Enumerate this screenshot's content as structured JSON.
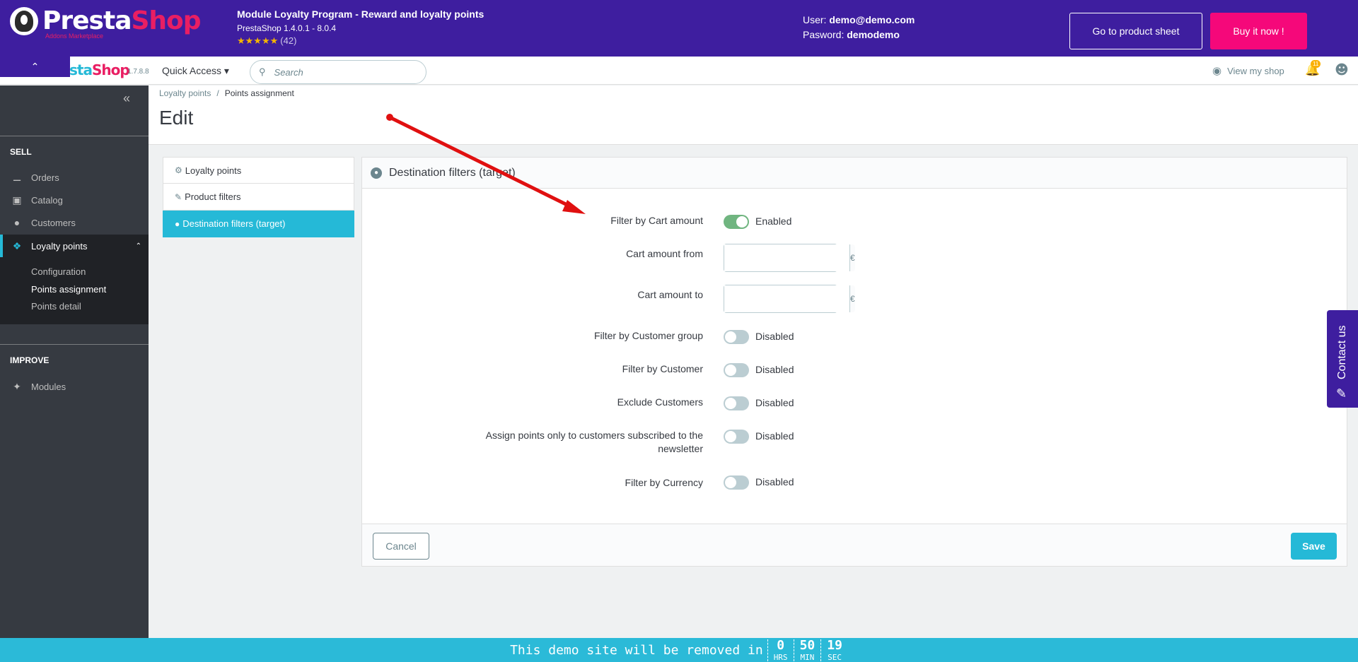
{
  "banner": {
    "logo_part1": "Presta",
    "logo_part2": "Shop",
    "logo_sub": "Addons Marketplace",
    "module_title": "Module Loyalty Program - Reward and loyalty points",
    "module_version": "PrestaShop 1.4.0.1 - 8.0.4",
    "rating_stars": "★★★★★",
    "rating_count": "(42)",
    "user_label": "User:",
    "user_value": "demo@demo.com",
    "password_label": "Pasword:",
    "password_value": "demodemo",
    "product_sheet_button": "Go to product sheet",
    "buy_button": "Buy it now !"
  },
  "header": {
    "collapse_icon": "chevron-up-icon",
    "logo_part1": "sta",
    "logo_part2": "Shop",
    "version": "1.7.8.8",
    "quick_access": "Quick Access ▾",
    "search_placeholder": "Search",
    "view_shop": "View my shop",
    "notification_count": "11"
  },
  "sidebar": {
    "sections": {
      "sell": "SELL",
      "improve": "IMPROVE"
    },
    "items": [
      {
        "label": "Orders",
        "icon": "basket-icon"
      },
      {
        "label": "Catalog",
        "icon": "store-icon"
      },
      {
        "label": "Customers",
        "icon": "user-circle-icon"
      },
      {
        "label": "Loyalty points",
        "icon": "tag-icon"
      },
      {
        "label": "Modules",
        "icon": "puzzle-icon"
      }
    ],
    "subitems": [
      {
        "label": "Configuration"
      },
      {
        "label": "Points assignment"
      },
      {
        "label": "Points detail"
      }
    ]
  },
  "page": {
    "breadcrumb": [
      "Loyalty points",
      "Points assignment"
    ],
    "title": "Edit"
  },
  "tabs": [
    {
      "label": "Loyalty points",
      "icon": "cogs-icon"
    },
    {
      "label": "Product filters",
      "icon": "edit-icon"
    },
    {
      "label": "Destination filters (target)",
      "icon": "globe-icon"
    }
  ],
  "panel": {
    "title": "Destination filters (target)",
    "fields": {
      "cart_amount_filter": {
        "label": "Filter by Cart amount",
        "state": "Enabled",
        "enabled": true
      },
      "cart_from": {
        "label": "Cart amount from",
        "value": "",
        "unit": "€"
      },
      "cart_to": {
        "label": "Cart amount to",
        "value": "",
        "unit": "€"
      },
      "customer_group": {
        "label": "Filter by Customer group",
        "state": "Disabled",
        "enabled": false
      },
      "customer": {
        "label": "Filter by Customer",
        "state": "Disabled",
        "enabled": false
      },
      "exclude": {
        "label": "Exclude Customers",
        "state": "Disabled",
        "enabled": false
      },
      "newsletter": {
        "label_line1": "Assign points only to customers subscribed to the",
        "label_line2": "newsletter",
        "state": "Disabled",
        "enabled": false
      },
      "currency": {
        "label": "Filter by Currency",
        "state": "Disabled",
        "enabled": false
      }
    },
    "cancel_button": "Cancel",
    "save_button": "Save"
  },
  "contact": {
    "label": "Contact us",
    "icon": "pencil-icon"
  },
  "demo_bar": {
    "message": "This demo site will be removed in",
    "hours": "0",
    "hours_unit": "HRS",
    "minutes": "50",
    "minutes_unit": "MIN",
    "seconds": "19",
    "seconds_unit": "SEC"
  },
  "colors": {
    "banner": "#3e1e9f",
    "accent": "#25b9d7",
    "buy": "#f5087a",
    "sidebar": "#363a41",
    "arrow": "#e01010"
  }
}
